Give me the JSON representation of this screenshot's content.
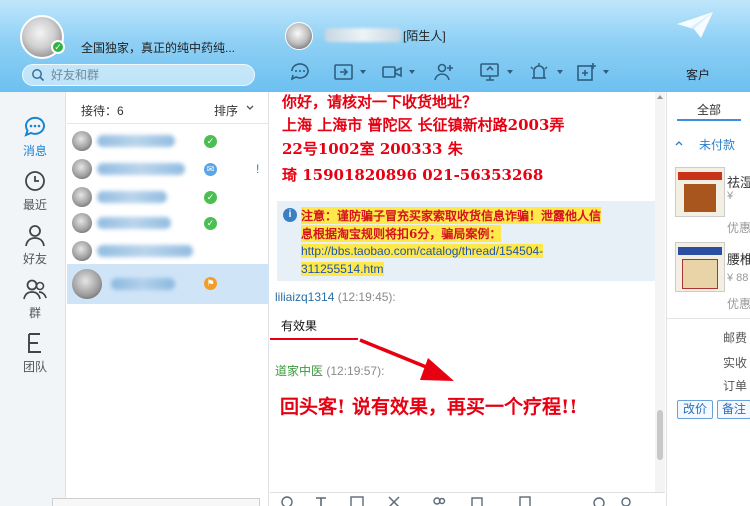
{
  "header": {
    "signature": "全国独家，真正的纯中药纯...",
    "search_placeholder": "好友和群",
    "chat_tag": "[陌生人]",
    "customer_tab": "客户"
  },
  "toolbar": {
    "icons": [
      "chat-plus-icon",
      "share-screen-icon",
      "video-icon",
      "add-member-icon",
      "remote-assist-icon",
      "app-icon",
      "more-apps-icon"
    ]
  },
  "nav": {
    "items": [
      {
        "label": "消息",
        "icon": "message-icon"
      },
      {
        "label": "最近",
        "icon": "clock-icon"
      },
      {
        "label": "好友",
        "icon": "person-icon"
      },
      {
        "label": "群",
        "icon": "group-icon"
      },
      {
        "label": "团队",
        "icon": "team-icon"
      }
    ]
  },
  "contacts": {
    "count_label": "接待：6",
    "sort_label": "排序",
    "rows": [
      {
        "status": "ok",
        "status_glyph": "✓",
        "bang": ""
      },
      {
        "status": "mail",
        "status_glyph": "✉",
        "bang": "!"
      },
      {
        "status": "ok",
        "status_glyph": "✓",
        "bang": ""
      },
      {
        "status": "ok",
        "status_glyph": "✓",
        "bang": ""
      },
      {
        "status": "",
        "status_glyph": "",
        "bang": ""
      },
      {
        "status": "lamp",
        "status_glyph": "⚑",
        "bang": ""
      }
    ]
  },
  "chat": {
    "big_lines": [
      "你好，请核对一下收货地址？",
      "上海  上海市  普陀区  长征镇新村路2003弄",
      "22号1002室  200333  朱",
      "琦  15901820896  021-56353268"
    ],
    "notice_line1": "注意：谨防骗子冒充买家索取收货信息诈骗！泄露他人信",
    "notice_line2": "息根据淘宝规则将扣6分，骗局案例：",
    "notice_link1": "http://bbs.taobao.com/catalog/thread/154504-",
    "notice_link2": "311255514.htm",
    "msg1_name": "liliaizq1314",
    "msg1_time": "(12:19:45):",
    "msg1_body": "有效果",
    "msg2_name": "道家中医",
    "msg2_time": "(12:19:57):",
    "callout": "回头客!  说有效果，再买一个疗程!!"
  },
  "right_panel": {
    "tab_all": "全部",
    "unpaid": "未付款",
    "products": [
      {
        "title": "祛湿",
        "price": "¥",
        "sub": "优惠"
      },
      {
        "title": "腰椎",
        "price": "¥ 88",
        "sub": "优惠"
      }
    ],
    "labels": [
      "邮费",
      "实收",
      "订单"
    ],
    "btn_modify": "改价",
    "btn_note": "备注"
  },
  "colors": {
    "accent_red": "#e60012",
    "link_blue": "#1e54b0",
    "highlight": "#ffe84a"
  }
}
